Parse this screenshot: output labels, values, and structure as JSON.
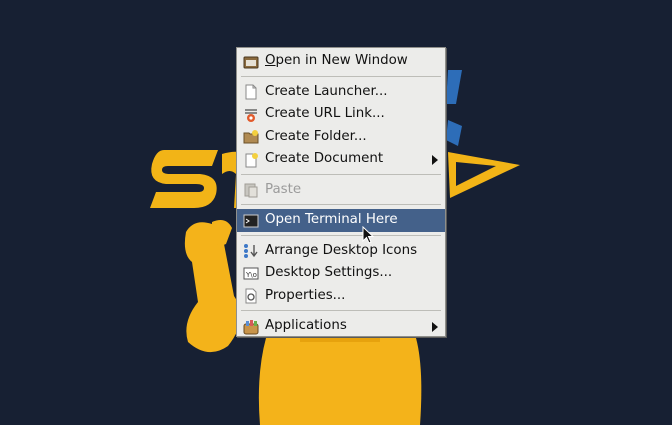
{
  "menu": {
    "items": [
      {
        "label": "Open in New Window",
        "icon": "folder-window-icon"
      },
      {
        "label": "Create Launcher...",
        "icon": "document-icon"
      },
      {
        "label": "Create URL Link...",
        "icon": "url-link-icon"
      },
      {
        "label": "Create Folder...",
        "icon": "folder-icon"
      },
      {
        "label": "Create Document",
        "icon": "new-document-icon",
        "submenu": true
      },
      {
        "label": "Paste",
        "icon": "paste-icon",
        "disabled": true
      },
      {
        "label": "Open Terminal Here",
        "icon": "terminal-icon",
        "highlighted": true
      },
      {
        "label": "Arrange Desktop Icons",
        "icon": "arrange-icons-icon"
      },
      {
        "label": "Desktop Settings...",
        "icon": "desktop-settings-icon"
      },
      {
        "label": "Properties...",
        "icon": "properties-icon"
      },
      {
        "label": "Applications",
        "icon": "applications-icon",
        "submenu": true
      }
    ]
  },
  "colors": {
    "desktop_bg": "#172033",
    "menu_bg": "#ececea",
    "highlight": "#44618a",
    "mascot_yellow": "#f4b31a"
  }
}
